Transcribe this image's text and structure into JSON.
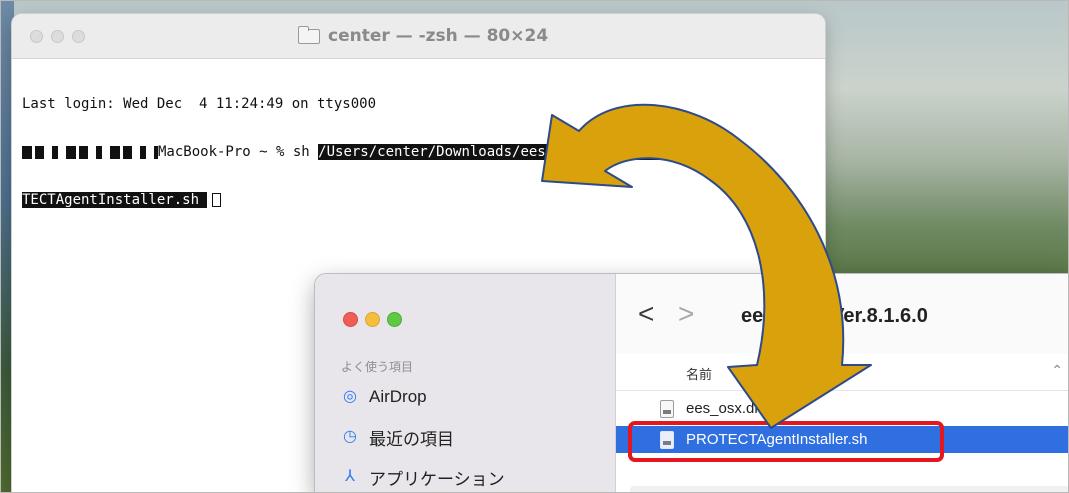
{
  "terminal": {
    "title": "center — -zsh — 80×24",
    "line1": "Last login: Wed Dec  4 11:24:49 on ttys000",
    "prompt_suffix": "MacBook-Pro ~ % sh ",
    "path_part1": "/Users/center/Downloads/ees_osx_Ver.8.1.6.0/PRO",
    "path_part2": "TECTAgentInstaller.sh "
  },
  "finder": {
    "folder_title": "ees_osx_Ver.8.1.6.0",
    "nav_back": "<",
    "nav_forward": ">",
    "sidebar": {
      "section_label": "よく使う項目",
      "items": [
        {
          "label": "AirDrop",
          "icon": "airdrop-icon"
        },
        {
          "label": "最近の項目",
          "icon": "clock-icon"
        },
        {
          "label": "アプリケーション",
          "icon": "applications-icon"
        }
      ]
    },
    "column_name": "名前",
    "files": [
      {
        "name": "ees_osx.dmg",
        "selected": false
      },
      {
        "name": "PROTECTAgentInstaller.sh",
        "selected": true
      }
    ]
  },
  "colors": {
    "highlight_box": "#e4161f",
    "arrow_fill": "#d9a10c",
    "arrow_stroke": "#2d4a8a",
    "selection": "#2f6fe0"
  }
}
